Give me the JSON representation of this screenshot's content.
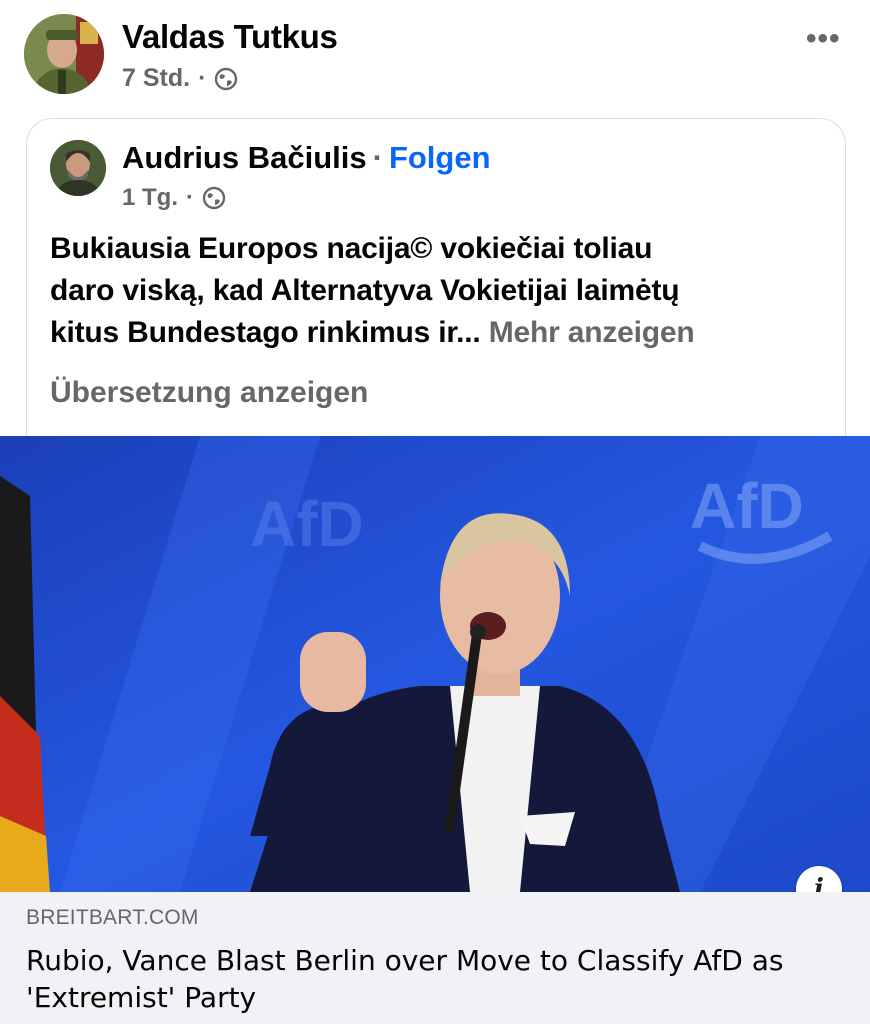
{
  "outer_post": {
    "author": "Valdas Tutkus",
    "time": "7 Std.",
    "separator": "·",
    "more_label": "•••"
  },
  "shared_post": {
    "author": "Audrius Bačiulis",
    "separator": "·",
    "follow_label": "Folgen",
    "time": "1 Tg.",
    "text_lines": [
      "Bukiausia Europos nacija© vokiečiai toliau",
      "daro viską, kad Alternatyva Vokietijai laimėtų",
      "kitus Bundestago rinkimus ir..."
    ],
    "see_more_label": "Mehr anzeigen",
    "translate_label": "Übersetzung anzeigen"
  },
  "link_preview": {
    "image_watermarks": [
      "AfD",
      "AfD"
    ],
    "info_icon_label": "i",
    "domain": "BREITBART.COM",
    "headline_lines": [
      "Rubio, Vance Blast Berlin over Move to Classify AfD as",
      "'Extremist' Party"
    ]
  },
  "icons": {
    "privacy": "globe-icon",
    "more": "more-dots-icon",
    "info": "info-icon"
  },
  "colors": {
    "link_blue": "#0866ff",
    "secondary_text": "#65676b",
    "preview_bg": "#f0f2f5",
    "stage_blue": "#1f4fd6"
  }
}
